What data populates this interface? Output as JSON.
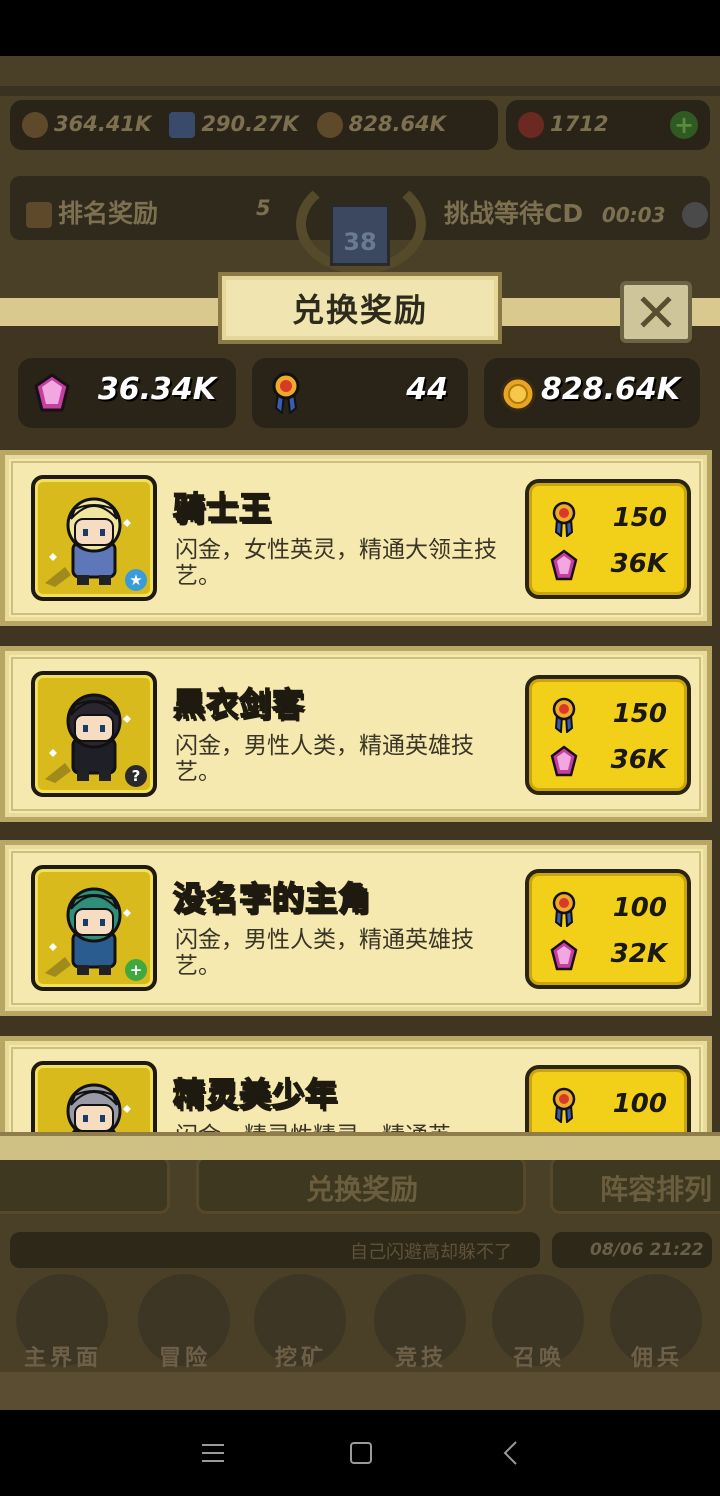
{
  "background": {
    "stats": [
      {
        "icon": "sword-icon",
        "value": "364.41K"
      },
      {
        "icon": "exp-icon",
        "value": "290.27K"
      },
      {
        "icon": "coin-icon",
        "value": "828.64K"
      },
      {
        "icon": "ruby-icon",
        "value": "1712"
      }
    ],
    "rank_reward_label": "排名奖励",
    "rank_reward_count": "5",
    "challenge_cd_label": "挑战等待CD",
    "challenge_cd_value": "00:03",
    "rank_badge": "38",
    "exchange_tab": "兑换奖励",
    "lineup_tab": "阵容排列",
    "chat_text": "自己闪避高却躲不了",
    "chat_time": "08/06 21:22",
    "nav": [
      {
        "label": "主界面",
        "icon": "map-icon"
      },
      {
        "label": "冒险",
        "icon": "adventure-icon"
      },
      {
        "label": "挖矿",
        "icon": "pickaxe-icon"
      },
      {
        "label": "竞技",
        "icon": "swords-icon"
      },
      {
        "label": "召唤",
        "icon": "scroll-icon"
      },
      {
        "label": "佣兵",
        "icon": "mercenary-icon"
      }
    ]
  },
  "modal": {
    "title": "兑换奖励",
    "resources": [
      {
        "icon": "gem-icon",
        "value": "36.34K"
      },
      {
        "icon": "medal-icon",
        "value": "44"
      },
      {
        "icon": "coin-icon",
        "value": "828.64K"
      }
    ],
    "heroes": [
      {
        "name": "骑士王",
        "desc": "闪金，女性英灵，精通大领主技艺。",
        "medal_cost": "150",
        "gem_cost": "36K",
        "badge": "★",
        "badge_color": "#3a9bd9",
        "hair": "#f1e6a0",
        "outfit": "#5d77b8"
      },
      {
        "name": "黑衣剑客",
        "desc": "闪金，男性人类，精通英雄技艺。",
        "medal_cost": "150",
        "gem_cost": "36K",
        "badge": "?",
        "badge_color": "#2a2a2a",
        "hair": "#2a2630",
        "outfit": "#1f1f28"
      },
      {
        "name": "没名字的主角",
        "desc": "闪金，男性人类，精通英雄技艺。",
        "medal_cost": "100",
        "gem_cost": "32K",
        "badge": "+",
        "badge_color": "#3fa83f",
        "hair": "#2f8f7a",
        "outfit": "#2b5c8f"
      },
      {
        "name": "精灵美少年",
        "desc": "闪金，精灵性精灵，精通英",
        "medal_cost": "100",
        "gem_cost": "",
        "badge": "",
        "badge_color": "#000000",
        "hair": "#9a9aa6",
        "outfit": "#5a6b3a"
      }
    ]
  },
  "colors": {
    "accent_gold": "#f2cf18",
    "name_yellow": "#ffd400",
    "card_bg": "#f5e9b0"
  }
}
